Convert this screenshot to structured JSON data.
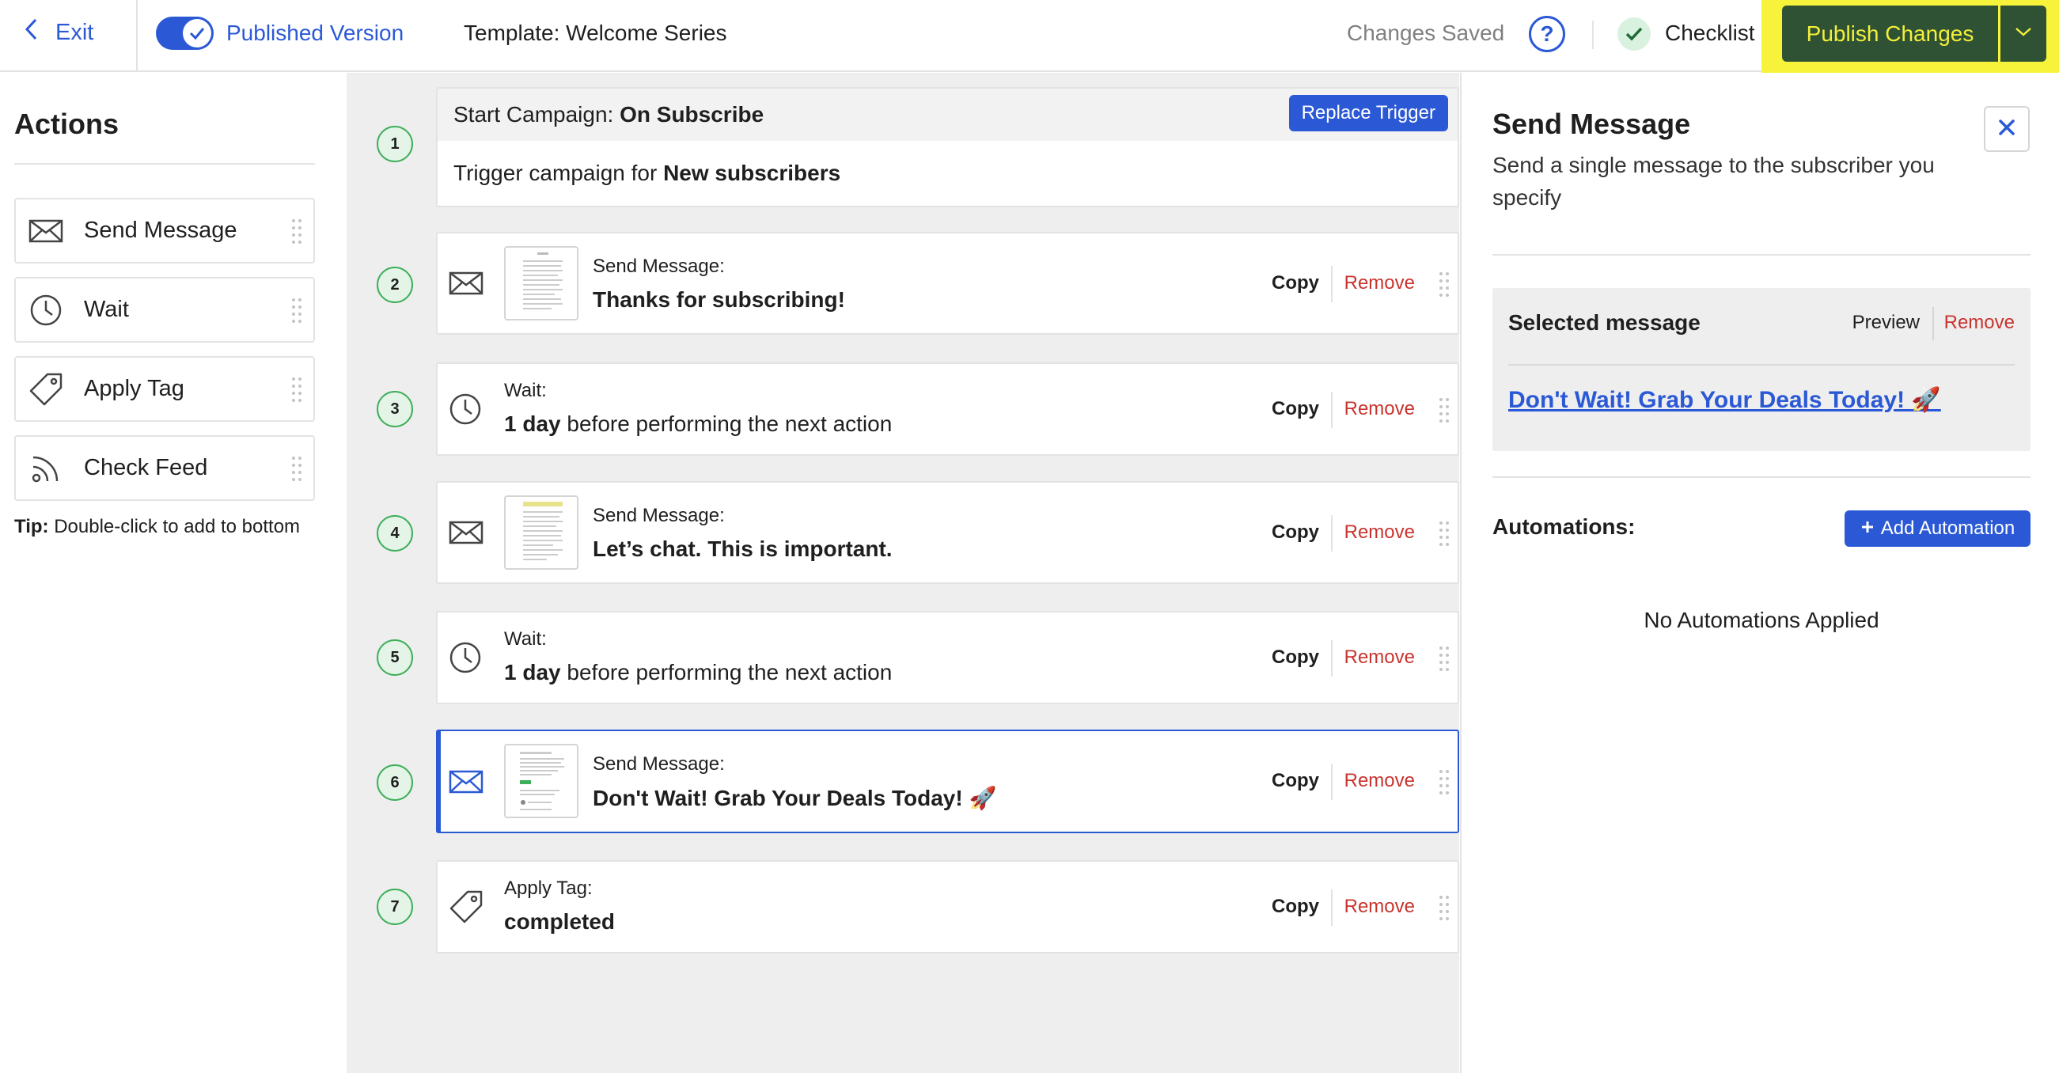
{
  "topbar": {
    "exit_label": "Exit",
    "published_version_label": "Published Version",
    "template_title": "Template: Welcome Series",
    "changes_status": "Changes Saved",
    "help_glyph": "?",
    "checklist_label": "Checklist",
    "publish_label": "Publish Changes",
    "colors": {
      "accent": "#2b59d6",
      "publish_bg": "#2e5233",
      "publish_text": "#f4ef3a",
      "highlight": "#f7f23a"
    }
  },
  "actions_panel": {
    "title": "Actions",
    "items": [
      {
        "label": "Send Message",
        "icon": "envelope-icon"
      },
      {
        "label": "Wait",
        "icon": "clock-icon"
      },
      {
        "label": "Apply Tag",
        "icon": "tag-icon"
      },
      {
        "label": "Check Feed",
        "icon": "rss-feed-icon"
      }
    ],
    "tip_prefix": "Tip:",
    "tip_text": "Double-click to add to bottom"
  },
  "workflow": {
    "copy_label": "Copy",
    "remove_label": "Remove",
    "trigger": {
      "step": "1",
      "head_prefix": "Start Campaign: ",
      "head_value": "On Subscribe",
      "replace_label": "Replace Trigger",
      "body_prefix": "Trigger campaign for ",
      "body_value": "New subscribers"
    },
    "steps": [
      {
        "step": "2",
        "type": "message",
        "label": "Send Message:",
        "value": "Thanks for subscribing!"
      },
      {
        "step": "3",
        "type": "wait",
        "label": "Wait:",
        "value_bold": "1 day",
        "value_rest": " before performing the next action"
      },
      {
        "step": "4",
        "type": "message",
        "label": "Send Message:",
        "value": "Let’s chat. This is important."
      },
      {
        "step": "5",
        "type": "wait",
        "label": "Wait:",
        "value_bold": "1 day",
        "value_rest": " before performing the next action"
      },
      {
        "step": "6",
        "type": "message",
        "label": "Send Message:",
        "value": "Don't Wait! Grab Your Deals Today! 🚀",
        "selected": true
      },
      {
        "step": "7",
        "type": "tag",
        "label": "Apply Tag:",
        "value": "completed"
      }
    ]
  },
  "details_panel": {
    "title": "Send Message",
    "description": "Send a single message to the subscriber you specify",
    "selected_message_label": "Selected message",
    "preview_label": "Preview",
    "remove_label": "Remove",
    "selected_message_link": "Don't Wait! Grab Your Deals Today! 🚀",
    "automations_label": "Automations:",
    "add_automation_label": "Add Automation",
    "no_automations": "No Automations Applied"
  }
}
